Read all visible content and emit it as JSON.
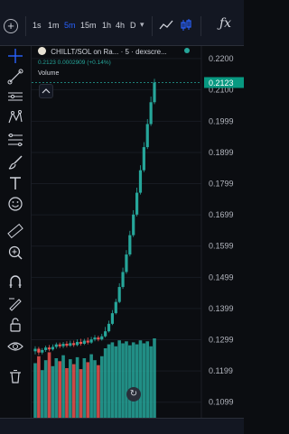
{
  "toolbar": {
    "intervals": [
      "1s",
      "1m",
      "5m",
      "15m",
      "1h",
      "4h",
      "D"
    ],
    "active_interval": "5m",
    "fx_label": "ƒx",
    "icons": [
      "plus-circle-icon",
      "line-chart-icon",
      "candlestick-icon",
      "chevron-down-icon",
      "indicators-icon"
    ]
  },
  "legend": {
    "symbol": "CHILLT/SOL on Ra...",
    "interval": "5",
    "source": "dexscre...",
    "ohlc": "0.2123  0.0002909 (+0.14%)",
    "volume_label": "Volume",
    "status_color": "#26a69a"
  },
  "sidebar_icons": [
    "crosshair-icon",
    "trend-line-icon",
    "horizontal-lines-icon",
    "pattern-icon",
    "fib-icon",
    "brush-icon",
    "text-icon",
    "emoji-icon",
    "ruler-icon",
    "zoom-in-icon",
    "magnet-icon",
    "lock-icon",
    "eye-icon",
    "trash-icon"
  ],
  "colors": {
    "up": "#26a69a",
    "down": "#ef5350",
    "background": "#0b0d11",
    "last_price_tag": "#089981",
    "active_interval": "#2962ff"
  },
  "chart_data": {
    "type": "candlestick",
    "title": "",
    "y_axis_ticks": [
      "0.2200",
      "0.2100",
      "0.1999",
      "0.1899",
      "0.1799",
      "0.1699",
      "0.1599",
      "0.1499",
      "0.1399",
      "0.1299",
      "0.1199",
      "0.1099"
    ],
    "ylim": [
      0.1049,
      0.224
    ],
    "last_price": "0.2123",
    "last_price_value": 0.2123,
    "candles": [
      {
        "o": 0.1262,
        "c": 0.127,
        "h": 0.1278,
        "l": 0.1252
      },
      {
        "o": 0.127,
        "c": 0.1258,
        "h": 0.1276,
        "l": 0.125
      },
      {
        "o": 0.1258,
        "c": 0.1266,
        "h": 0.1272,
        "l": 0.1252
      },
      {
        "o": 0.1266,
        "c": 0.1274,
        "h": 0.128,
        "l": 0.126
      },
      {
        "o": 0.1274,
        "c": 0.1268,
        "h": 0.1282,
        "l": 0.1262
      },
      {
        "o": 0.1268,
        "c": 0.1276,
        "h": 0.1284,
        "l": 0.1264
      },
      {
        "o": 0.1276,
        "c": 0.1284,
        "h": 0.129,
        "l": 0.127
      },
      {
        "o": 0.1284,
        "c": 0.1278,
        "h": 0.129,
        "l": 0.1272
      },
      {
        "o": 0.1278,
        "c": 0.1286,
        "h": 0.1292,
        "l": 0.1272
      },
      {
        "o": 0.1286,
        "c": 0.128,
        "h": 0.1294,
        "l": 0.1274
      },
      {
        "o": 0.128,
        "c": 0.1288,
        "h": 0.1296,
        "l": 0.1276
      },
      {
        "o": 0.1288,
        "c": 0.1282,
        "h": 0.1296,
        "l": 0.1276
      },
      {
        "o": 0.1282,
        "c": 0.1292,
        "h": 0.13,
        "l": 0.1278
      },
      {
        "o": 0.1292,
        "c": 0.1286,
        "h": 0.1302,
        "l": 0.128
      },
      {
        "o": 0.1286,
        "c": 0.1296,
        "h": 0.1302,
        "l": 0.1282
      },
      {
        "o": 0.1296,
        "c": 0.129,
        "h": 0.1306,
        "l": 0.1284
      },
      {
        "o": 0.129,
        "c": 0.13,
        "h": 0.1308,
        "l": 0.1286
      },
      {
        "o": 0.13,
        "c": 0.1306,
        "h": 0.1314,
        "l": 0.1294
      },
      {
        "o": 0.1306,
        "c": 0.13,
        "h": 0.1312,
        "l": 0.1294
      },
      {
        "o": 0.13,
        "c": 0.131,
        "h": 0.1318,
        "l": 0.1296
      },
      {
        "o": 0.131,
        "c": 0.1326,
        "h": 0.134,
        "l": 0.1306
      },
      {
        "o": 0.1326,
        "c": 0.135,
        "h": 0.136,
        "l": 0.1322
      },
      {
        "o": 0.135,
        "c": 0.1384,
        "h": 0.1394,
        "l": 0.1346
      },
      {
        "o": 0.1384,
        "c": 0.142,
        "h": 0.143,
        "l": 0.138
      },
      {
        "o": 0.142,
        "c": 0.1468,
        "h": 0.148,
        "l": 0.1416
      },
      {
        "o": 0.1468,
        "c": 0.1516,
        "h": 0.153,
        "l": 0.1462
      },
      {
        "o": 0.1516,
        "c": 0.1572,
        "h": 0.1586,
        "l": 0.151
      },
      {
        "o": 0.1572,
        "c": 0.1634,
        "h": 0.1648,
        "l": 0.1566
      },
      {
        "o": 0.1634,
        "c": 0.17,
        "h": 0.1714,
        "l": 0.1628
      },
      {
        "o": 0.17,
        "c": 0.177,
        "h": 0.1786,
        "l": 0.1694
      },
      {
        "o": 0.177,
        "c": 0.1842,
        "h": 0.1858,
        "l": 0.1764
      },
      {
        "o": 0.1842,
        "c": 0.1916,
        "h": 0.1932,
        "l": 0.1836
      },
      {
        "o": 0.1916,
        "c": 0.199,
        "h": 0.2006,
        "l": 0.191
      },
      {
        "o": 0.199,
        "c": 0.206,
        "h": 0.2078,
        "l": 0.1984
      },
      {
        "o": 0.206,
        "c": 0.2123,
        "h": 0.2135,
        "l": 0.2054
      }
    ],
    "volume": [
      0.55,
      0.62,
      0.48,
      0.58,
      0.66,
      0.52,
      0.6,
      0.57,
      0.63,
      0.5,
      0.59,
      0.54,
      0.61,
      0.49,
      0.6,
      0.56,
      0.64,
      0.58,
      0.53,
      0.62,
      0.7,
      0.74,
      0.76,
      0.72,
      0.78,
      0.75,
      0.77,
      0.73,
      0.76,
      0.74,
      0.78,
      0.75,
      0.77,
      0.72,
      0.8
    ],
    "grid": true,
    "legend": "top-left"
  }
}
